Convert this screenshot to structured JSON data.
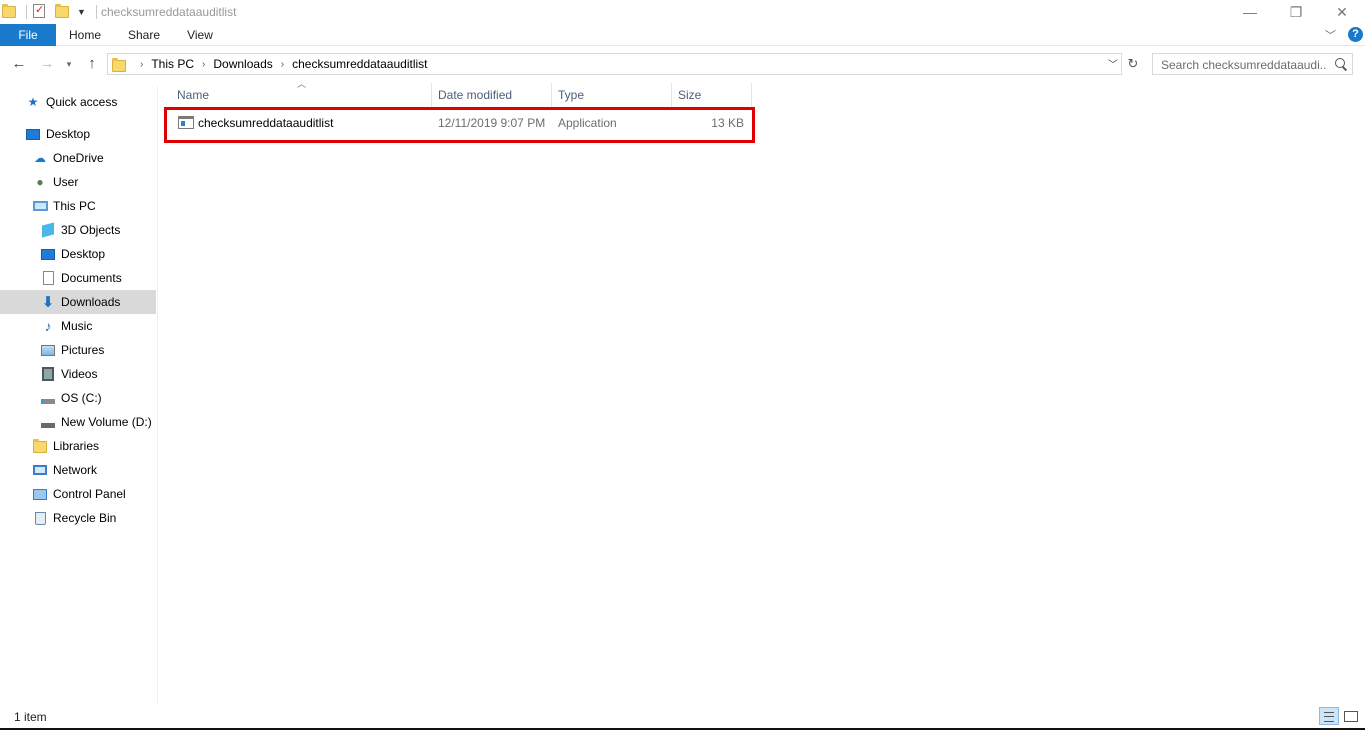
{
  "window": {
    "title": "checksumreddataauditlist",
    "minimize_glyph": "—",
    "maximize_glyph": "❐",
    "close_glyph": "✕"
  },
  "ribbon": {
    "tabs": [
      "File",
      "Home",
      "Share",
      "View"
    ],
    "accent_color": "#1979ca",
    "help_glyph": "?"
  },
  "navigation": {
    "back_glyph": "←",
    "forward_glyph": "→",
    "up_glyph": "↑",
    "breadcrumbs": [
      "This PC",
      "Downloads",
      "checksumreddataauditlist"
    ],
    "search_placeholder": "Search checksumreddataaudi..."
  },
  "sidebar": {
    "items": [
      {
        "label": "Quick access",
        "icon": "star-icon"
      },
      {
        "label": "Desktop",
        "icon": "desktop-icon"
      },
      {
        "label": "OneDrive",
        "icon": "cloud-icon"
      },
      {
        "label": "User",
        "icon": "user-icon"
      },
      {
        "label": "This PC",
        "icon": "computer-icon"
      },
      {
        "label": "3D Objects",
        "icon": "cube-icon"
      },
      {
        "label": "Desktop",
        "icon": "desktop-icon"
      },
      {
        "label": "Documents",
        "icon": "document-icon"
      },
      {
        "label": "Downloads",
        "icon": "download-icon"
      },
      {
        "label": "Music",
        "icon": "music-icon"
      },
      {
        "label": "Pictures",
        "icon": "picture-icon"
      },
      {
        "label": "Videos",
        "icon": "video-icon"
      },
      {
        "label": "OS (C:)",
        "icon": "drive-icon"
      },
      {
        "label": "New Volume (D:)",
        "icon": "drive-icon"
      },
      {
        "label": "Libraries",
        "icon": "library-icon"
      },
      {
        "label": "Network",
        "icon": "network-icon"
      },
      {
        "label": "Control Panel",
        "icon": "control-panel-icon"
      },
      {
        "label": "Recycle Bin",
        "icon": "recycle-bin-icon"
      }
    ],
    "selected": "Downloads"
  },
  "filelist": {
    "columns": [
      "Name",
      "Date modified",
      "Type",
      "Size"
    ],
    "rows": [
      {
        "name": "checksumreddataauditlist",
        "date": "12/11/2019 9:07 PM",
        "type": "Application",
        "size": "13 KB"
      }
    ],
    "highlight_color": "#e00000"
  },
  "status": {
    "item_count": "1 item"
  }
}
